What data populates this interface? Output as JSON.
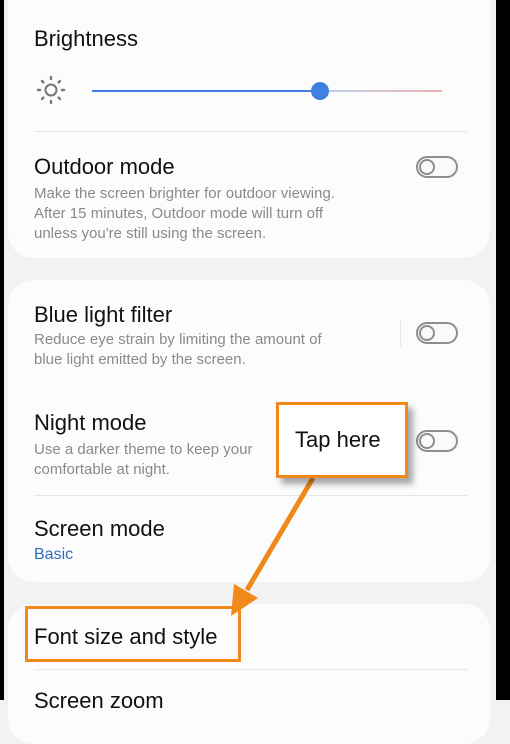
{
  "colors": {
    "accent_blue": "#3f7fe0",
    "link_blue": "#2f6fbd",
    "annotation_orange": "#f0881a",
    "slider_end_red": "#f2b2b2"
  },
  "brightness": {
    "title": "Brightness",
    "icon": "sun-icon",
    "level": 0.65
  },
  "outdoor_mode": {
    "title": "Outdoor mode",
    "description_lines": [
      "Make the screen brighter for outdoor viewing.",
      "After 15 minutes, Outdoor mode will turn off",
      "unless you're still using the screen."
    ],
    "enabled": false
  },
  "blue_light_filter": {
    "title": "Blue light filter",
    "description_lines": [
      "Reduce eye strain by limiting the amount of",
      "blue light emitted by the screen."
    ],
    "enabled": false
  },
  "night_mode": {
    "title": "Night mode",
    "description_lines": [
      "Use a darker theme to keep your",
      "comfortable at night."
    ],
    "enabled": false
  },
  "screen_mode": {
    "title": "Screen mode",
    "value": "Basic"
  },
  "font_size_style": {
    "title": "Font size and style"
  },
  "screen_zoom": {
    "title": "Screen zoom"
  },
  "annotation": {
    "callout_text": "Tap here"
  }
}
